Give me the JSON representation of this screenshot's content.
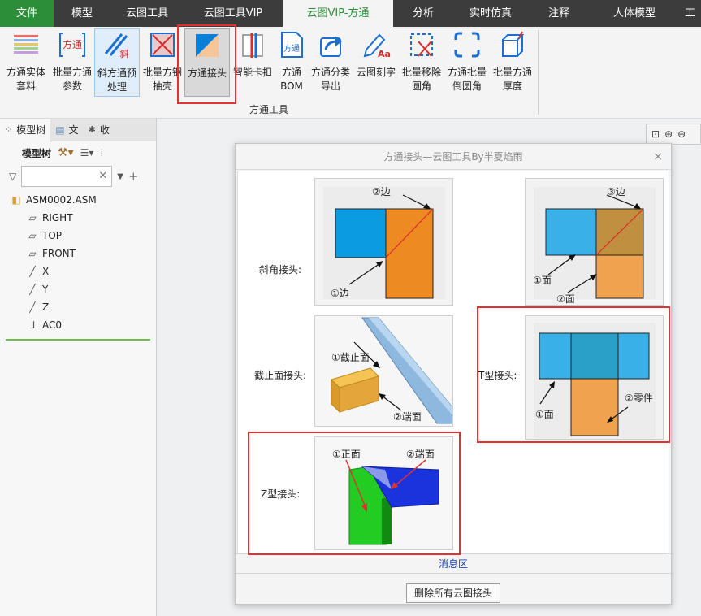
{
  "menu": {
    "tabs": [
      "文件",
      "模型",
      "云图工具",
      "云图工具VIP",
      "云图VIP-方通",
      "分析",
      "实时仿真",
      "注释",
      "人体模型",
      "工"
    ],
    "active": "云图VIP-方通"
  },
  "ribbon": {
    "buttons": [
      {
        "l1": "方通实体",
        "l2": "套料"
      },
      {
        "l1": "批量方通",
        "l2": "参数"
      },
      {
        "l1": "斜方通预",
        "l2": "处理"
      },
      {
        "l1": "批量方钢",
        "l2": "抽壳"
      },
      {
        "l1": "方通接头",
        "l2": ""
      },
      {
        "l1": "智能卡扣",
        "l2": ""
      },
      {
        "l1": "方通",
        "l2": "BOM"
      },
      {
        "l1": "方通分类",
        "l2": "导出"
      },
      {
        "l1": "云图刻字",
        "l2": ""
      },
      {
        "l1": "批量移除",
        "l2": "圆角"
      },
      {
        "l1": "方通批量",
        "l2": "倒圆角"
      },
      {
        "l1": "批量方通",
        "l2": "厚度"
      }
    ],
    "icon_text": {
      "fangtong": "方通",
      "xie": "斜",
      "bom": "方通",
      "aa": "Aa"
    },
    "group_label": "方通工具"
  },
  "left_panel": {
    "tabs": [
      "模型树",
      "文",
      "收"
    ],
    "toolbar_label": "模型树",
    "search_value": "",
    "tree": [
      {
        "label": "ASM0002.ASM",
        "icon": "assembly-icon"
      },
      {
        "label": "RIGHT",
        "icon": "datum-plane-icon"
      },
      {
        "label": "TOP",
        "icon": "datum-plane-icon"
      },
      {
        "label": "FRONT",
        "icon": "datum-plane-icon"
      },
      {
        "label": "X",
        "icon": "datum-axis-icon"
      },
      {
        "label": "Y",
        "icon": "datum-axis-icon"
      },
      {
        "label": "Z",
        "icon": "datum-axis-icon"
      },
      {
        "label": "AC0",
        "icon": "coordinate-system-icon"
      }
    ]
  },
  "dialog": {
    "title": "方通接头—云图工具By半夏焰雨",
    "close": "×",
    "joints": [
      {
        "label": "斜角接头:",
        "annotations": [
          "②边",
          "①边"
        ]
      },
      {
        "label": "",
        "annotations": [
          "③边",
          "①面",
          "②面"
        ]
      },
      {
        "label": "截止面接头:",
        "annotations": [
          "①截止面",
          "②端面"
        ]
      },
      {
        "label": "T型接头:",
        "annotations": [
          "①面",
          "②零件"
        ]
      },
      {
        "label": "Z型接头:",
        "annotations": [
          "①正面",
          "②端面"
        ]
      }
    ],
    "message_area": "消息区",
    "delete_button": "删除所有云图接头"
  },
  "colors": {
    "menu_bg": "#3c3c3c",
    "file_tab": "#2d8e3a",
    "highlight_red": "#e53030",
    "blue_part": "#0a9be0",
    "orange_part": "#ee8a22",
    "light_blue_part": "#39b0e8",
    "light_orange_part": "#f0a24f",
    "green_part": "#22cc22",
    "dark_blue_part": "#1a33dd"
  }
}
